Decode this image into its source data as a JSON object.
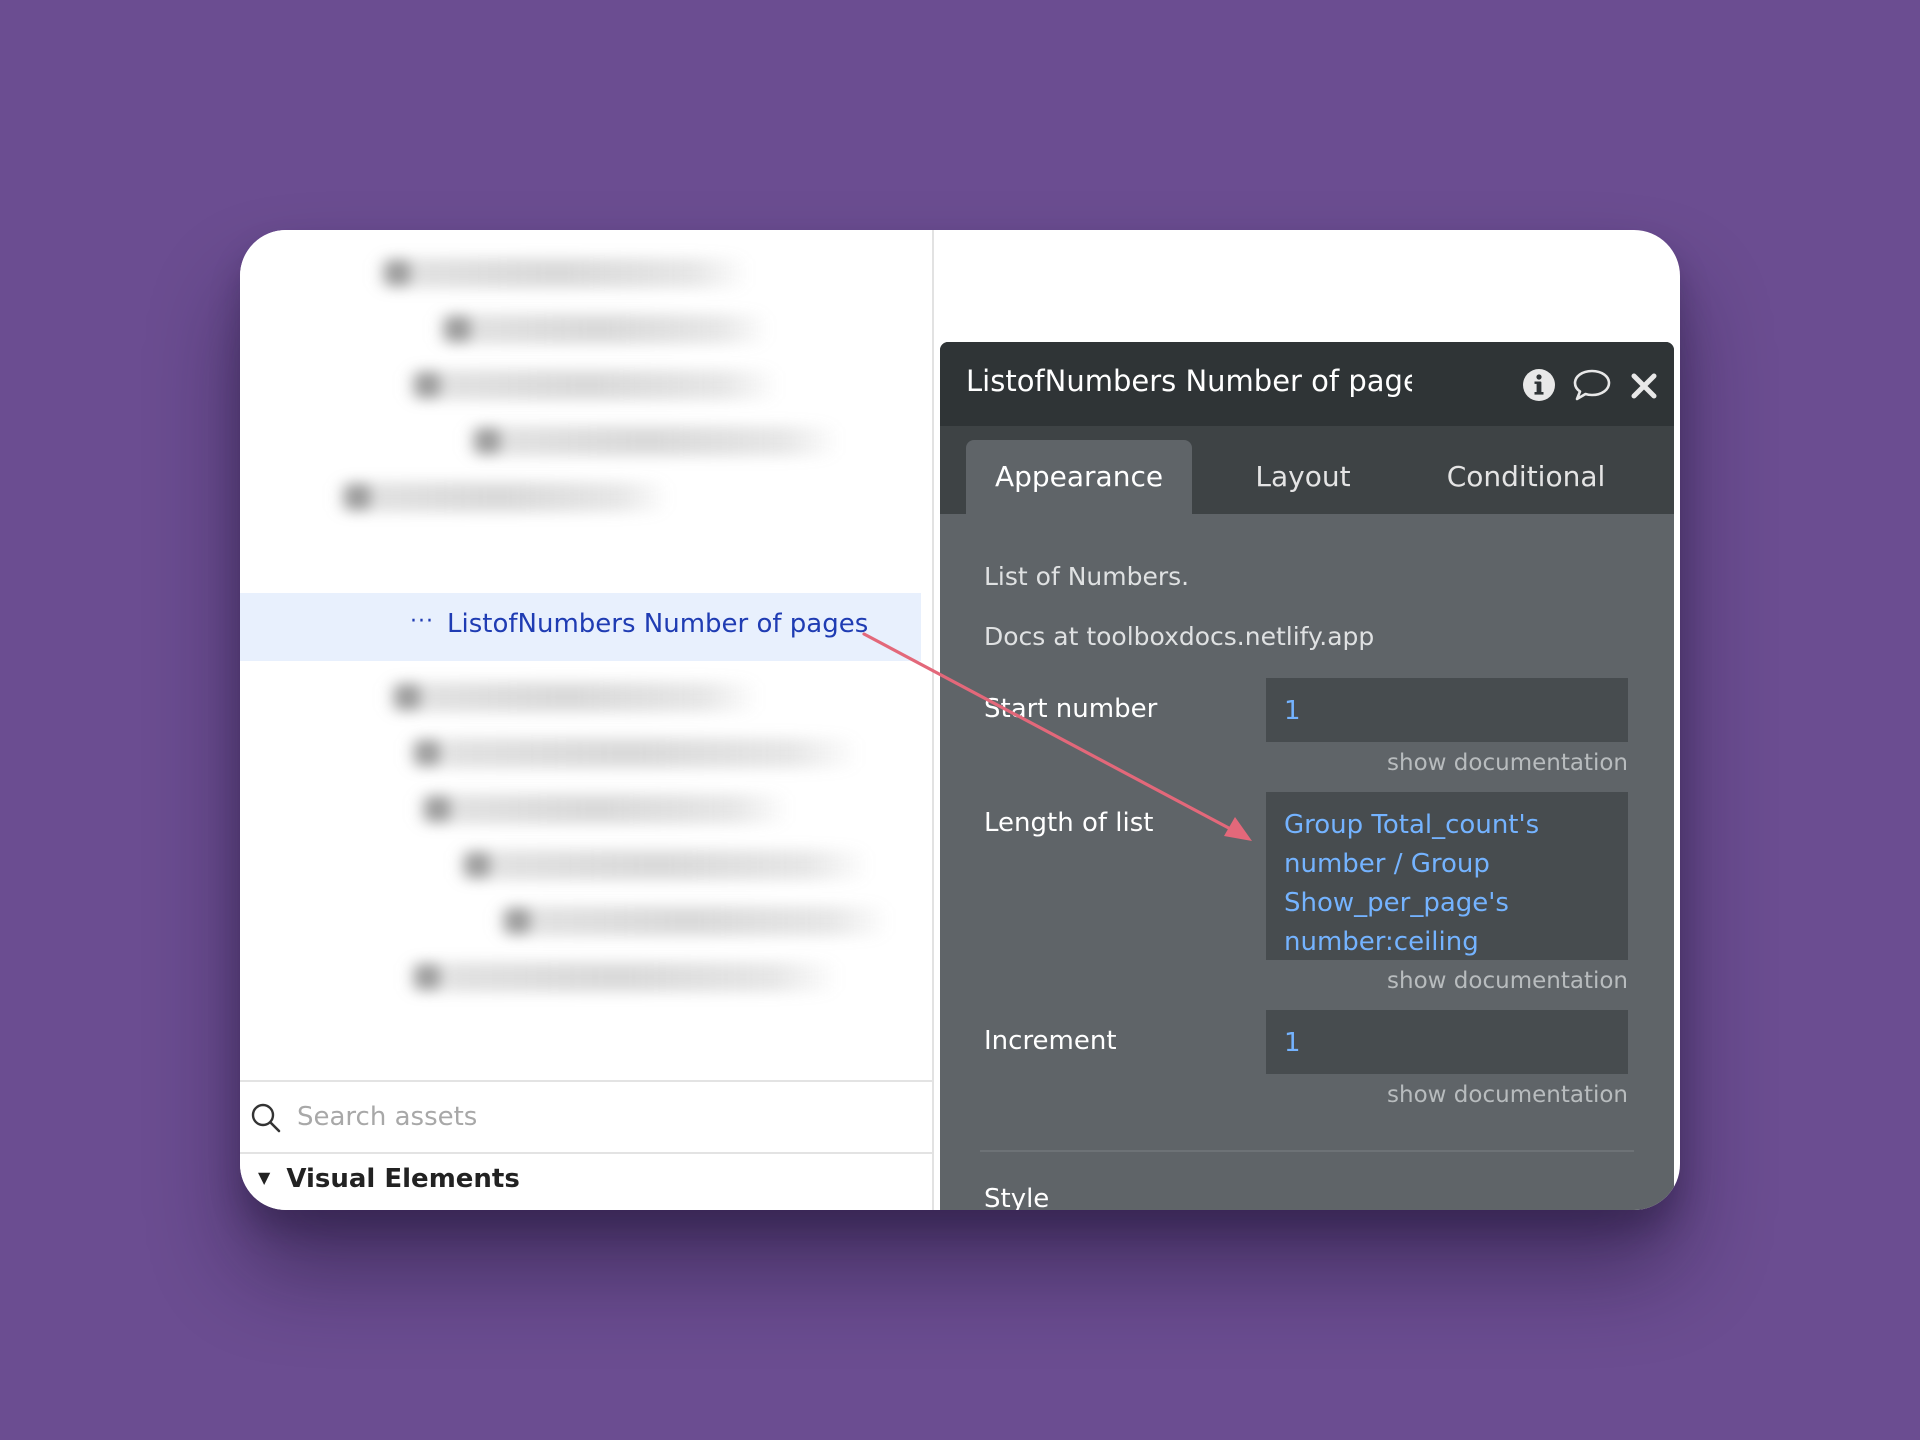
{
  "tree": {
    "selected_item": {
      "dots": "···",
      "label": "ListofNumbers Number of pages"
    }
  },
  "search": {
    "placeholder": "Search assets"
  },
  "section": {
    "label": "Visual Elements"
  },
  "panel": {
    "title": "ListofNumbers Number of pages",
    "icons": [
      "info-icon",
      "comment-icon",
      "close-icon"
    ],
    "tabs": [
      {
        "label": "Appearance",
        "active": true
      },
      {
        "label": "Layout",
        "active": false
      },
      {
        "label": "Conditional",
        "active": false
      }
    ],
    "description": "List of Numbers.",
    "docs": "Docs at toolboxdocs.netlify.app",
    "fields": [
      {
        "label": "Start number",
        "value": "1",
        "doc": "show documentation"
      },
      {
        "label": "Length of list",
        "value": "Group Total_count's number / Group Show_per_page's number:ceiling",
        "doc": "show documentation"
      },
      {
        "label": "Increment",
        "value": "1",
        "doc": "show documentation"
      }
    ],
    "style_label": "Style"
  },
  "colors": {
    "background": "#6b4d91",
    "panel": "#5f6468",
    "panel_header": "#2f3436",
    "field_value": "#74b3ff",
    "selected_text": "#1f3cb3",
    "selected_bg": "#e8f0fd",
    "arrow": "#e3687a"
  }
}
